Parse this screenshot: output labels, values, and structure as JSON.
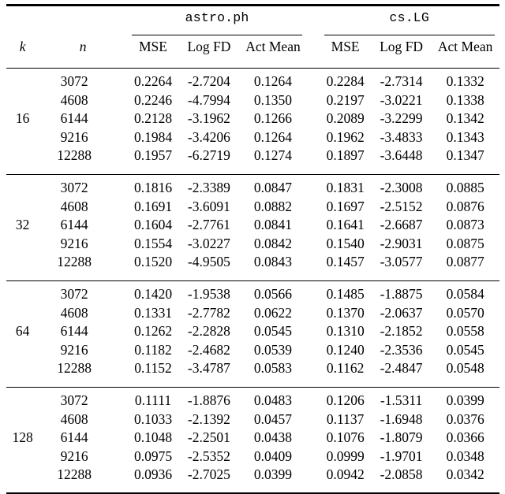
{
  "table": {
    "caption": "",
    "index_headers": {
      "k": "k",
      "n": "n"
    },
    "groups": [
      {
        "name": "astro.ph"
      },
      {
        "name": "cs.LG"
      }
    ],
    "metric_headers": [
      "MSE",
      "Log FD",
      "Act Mean"
    ],
    "blocks": [
      {
        "k": "16",
        "rows": [
          {
            "n": "3072",
            "astro_mse": "0.2264",
            "astro_logfd": "-2.7204",
            "astro_actmean": "0.1264",
            "cslg_mse": "0.2284",
            "cslg_logfd": "-2.7314",
            "cslg_actmean": "0.1332"
          },
          {
            "n": "4608",
            "astro_mse": "0.2246",
            "astro_logfd": "-4.7994",
            "astro_actmean": "0.1350",
            "cslg_mse": "0.2197",
            "cslg_logfd": "-3.0221",
            "cslg_actmean": "0.1338"
          },
          {
            "n": "6144",
            "astro_mse": "0.2128",
            "astro_logfd": "-3.1962",
            "astro_actmean": "0.1266",
            "cslg_mse": "0.2089",
            "cslg_logfd": "-3.2299",
            "cslg_actmean": "0.1342"
          },
          {
            "n": "9216",
            "astro_mse": "0.1984",
            "astro_logfd": "-3.4206",
            "astro_actmean": "0.1264",
            "cslg_mse": "0.1962",
            "cslg_logfd": "-3.4833",
            "cslg_actmean": "0.1343"
          },
          {
            "n": "12288",
            "astro_mse": "0.1957",
            "astro_logfd": "-6.2719",
            "astro_actmean": "0.1274",
            "cslg_mse": "0.1897",
            "cslg_logfd": "-3.6448",
            "cslg_actmean": "0.1347"
          }
        ]
      },
      {
        "k": "32",
        "rows": [
          {
            "n": "3072",
            "astro_mse": "0.1816",
            "astro_logfd": "-2.3389",
            "astro_actmean": "0.0847",
            "cslg_mse": "0.1831",
            "cslg_logfd": "-2.3008",
            "cslg_actmean": "0.0885"
          },
          {
            "n": "4608",
            "astro_mse": "0.1691",
            "astro_logfd": "-3.6091",
            "astro_actmean": "0.0882",
            "cslg_mse": "0.1697",
            "cslg_logfd": "-2.5152",
            "cslg_actmean": "0.0876"
          },
          {
            "n": "6144",
            "astro_mse": "0.1604",
            "astro_logfd": "-2.7761",
            "astro_actmean": "0.0841",
            "cslg_mse": "0.1641",
            "cslg_logfd": "-2.6687",
            "cslg_actmean": "0.0873"
          },
          {
            "n": "9216",
            "astro_mse": "0.1554",
            "astro_logfd": "-3.0227",
            "astro_actmean": "0.0842",
            "cslg_mse": "0.1540",
            "cslg_logfd": "-2.9031",
            "cslg_actmean": "0.0875"
          },
          {
            "n": "12288",
            "astro_mse": "0.1520",
            "astro_logfd": "-4.9505",
            "astro_actmean": "0.0843",
            "cslg_mse": "0.1457",
            "cslg_logfd": "-3.0577",
            "cslg_actmean": "0.0877"
          }
        ]
      },
      {
        "k": "64",
        "rows": [
          {
            "n": "3072",
            "astro_mse": "0.1420",
            "astro_logfd": "-1.9538",
            "astro_actmean": "0.0566",
            "cslg_mse": "0.1485",
            "cslg_logfd": "-1.8875",
            "cslg_actmean": "0.0584"
          },
          {
            "n": "4608",
            "astro_mse": "0.1331",
            "astro_logfd": "-2.7782",
            "astro_actmean": "0.0622",
            "cslg_mse": "0.1370",
            "cslg_logfd": "-2.0637",
            "cslg_actmean": "0.0570"
          },
          {
            "n": "6144",
            "astro_mse": "0.1262",
            "astro_logfd": "-2.2828",
            "astro_actmean": "0.0545",
            "cslg_mse": "0.1310",
            "cslg_logfd": "-2.1852",
            "cslg_actmean": "0.0558"
          },
          {
            "n": "9216",
            "astro_mse": "0.1182",
            "astro_logfd": "-2.4682",
            "astro_actmean": "0.0539",
            "cslg_mse": "0.1240",
            "cslg_logfd": "-2.3536",
            "cslg_actmean": "0.0545"
          },
          {
            "n": "12288",
            "astro_mse": "0.1152",
            "astro_logfd": "-3.4787",
            "astro_actmean": "0.0583",
            "cslg_mse": "0.1162",
            "cslg_logfd": "-2.4847",
            "cslg_actmean": "0.0548"
          }
        ]
      },
      {
        "k": "128",
        "rows": [
          {
            "n": "3072",
            "astro_mse": "0.1111",
            "astro_logfd": "-1.8876",
            "astro_actmean": "0.0483",
            "cslg_mse": "0.1206",
            "cslg_logfd": "-1.5311",
            "cslg_actmean": "0.0399"
          },
          {
            "n": "4608",
            "astro_mse": "0.1033",
            "astro_logfd": "-2.1392",
            "astro_actmean": "0.0457",
            "cslg_mse": "0.1137",
            "cslg_logfd": "-1.6948",
            "cslg_actmean": "0.0376"
          },
          {
            "n": "6144",
            "astro_mse": "0.1048",
            "astro_logfd": "-2.2501",
            "astro_actmean": "0.0438",
            "cslg_mse": "0.1076",
            "cslg_logfd": "-1.8079",
            "cslg_actmean": "0.0366"
          },
          {
            "n": "9216",
            "astro_mse": "0.0975",
            "astro_logfd": "-2.5352",
            "astro_actmean": "0.0409",
            "cslg_mse": "0.0999",
            "cslg_logfd": "-1.9701",
            "cslg_actmean": "0.0348"
          },
          {
            "n": "12288",
            "astro_mse": "0.0936",
            "astro_logfd": "-2.7025",
            "astro_actmean": "0.0399",
            "cslg_mse": "0.0942",
            "cslg_logfd": "-2.0858",
            "cslg_actmean": "0.0342"
          }
        ]
      }
    ]
  }
}
